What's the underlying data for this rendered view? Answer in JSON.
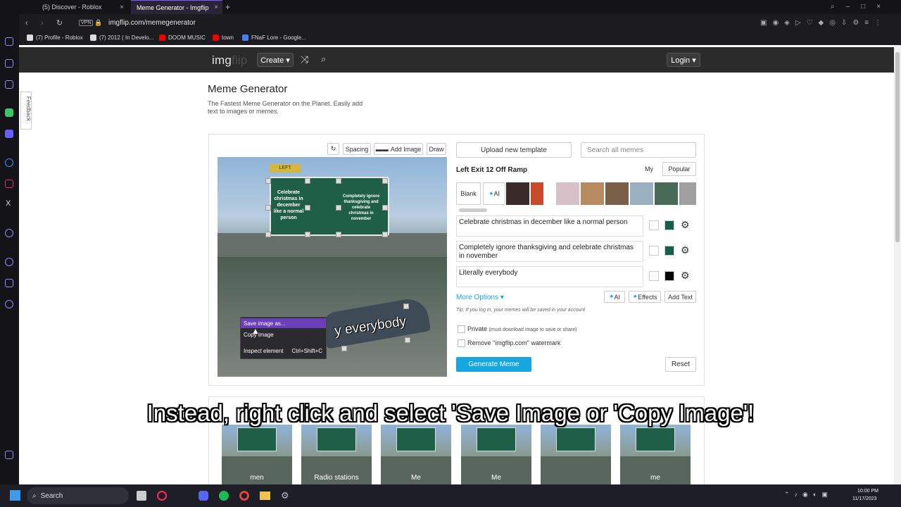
{
  "browser": {
    "tabs": [
      {
        "label": "(5) Discover - Roblox",
        "active": false
      },
      {
        "label": "Meme Generator - Imgflip",
        "active": true
      }
    ],
    "url": "imgflip.com/memegenerator",
    "vpn": "VPN",
    "bookmarks": [
      "(7) Profile - Roblox",
      "(7) 2012 ( In Develo...",
      "DOOM MUSIC",
      "town",
      "FNaF Lore - Google..."
    ]
  },
  "site": {
    "logo_a": "img",
    "logo_b": "flip",
    "create_label": "Create ▾",
    "login_label": "Login ▾",
    "feedback": "Feedback",
    "title": "Meme Generator",
    "subtitle": "The Fastest Meme Generator on the Planet. Easily add text to images or memes."
  },
  "editor": {
    "toolbar": {
      "spacing": "Spacing",
      "add_image": "Add Image",
      "draw": "Draw"
    },
    "meme_texts": {
      "left_sign": "Celebrate christmas in december like a normal person",
      "right_sign": "Completely ignore thanksgiving and celebrate christmas in november",
      "car": "y everybody",
      "sign_top": "LEFT"
    },
    "context_menu": {
      "save": "Save image as...",
      "copy": "Copy image",
      "inspect": "Inspect element",
      "shortcut": "Ctrl+Shift+C"
    },
    "upload_label": "Upload new template",
    "search_placeholder": "Search all memes",
    "template_name": "Left Exit 12 Off Ramp",
    "my_tab": "My",
    "popular_tab": "Popular",
    "blank": "Blank",
    "ai": "AI",
    "text_boxes": [
      {
        "value": "Celebrate christmas in december like a normal person",
        "color": "#155e4e"
      },
      {
        "value": "Completely ignore thanksgiving and celebrate christmas in november",
        "color": "#155e4e"
      },
      {
        "value": "Literally everybody",
        "color": "#000000"
      }
    ],
    "more_options": "More Options ▾",
    "ai_btn": "AI",
    "effects_btn": "Effects",
    "add_text_btn": "Add Text",
    "tip": "Tip: If you log in, your memes will be saved in your account",
    "private_label": "Private",
    "private_note": "(must download image to save or share)",
    "watermark_label": "Remove \"imgflip.com\" watermark",
    "generate": "Generate Meme",
    "reset": "Reset"
  },
  "caption": "Instead, right click and select 'Save Image or 'Copy Image'!",
  "gallery": {
    "thumb_texts": [
      "men",
      "Radio stations",
      "Me",
      "Me",
      "",
      "me"
    ]
  },
  "taskbar": {
    "search": "Search",
    "time": "10:00 PM",
    "date": "11/17/2023"
  },
  "colors": {
    "accent": "#17a7e0",
    "nav": "#2b2b2b",
    "sign": "#1f5f48",
    "menu_highlight": "#6a3fb8"
  }
}
